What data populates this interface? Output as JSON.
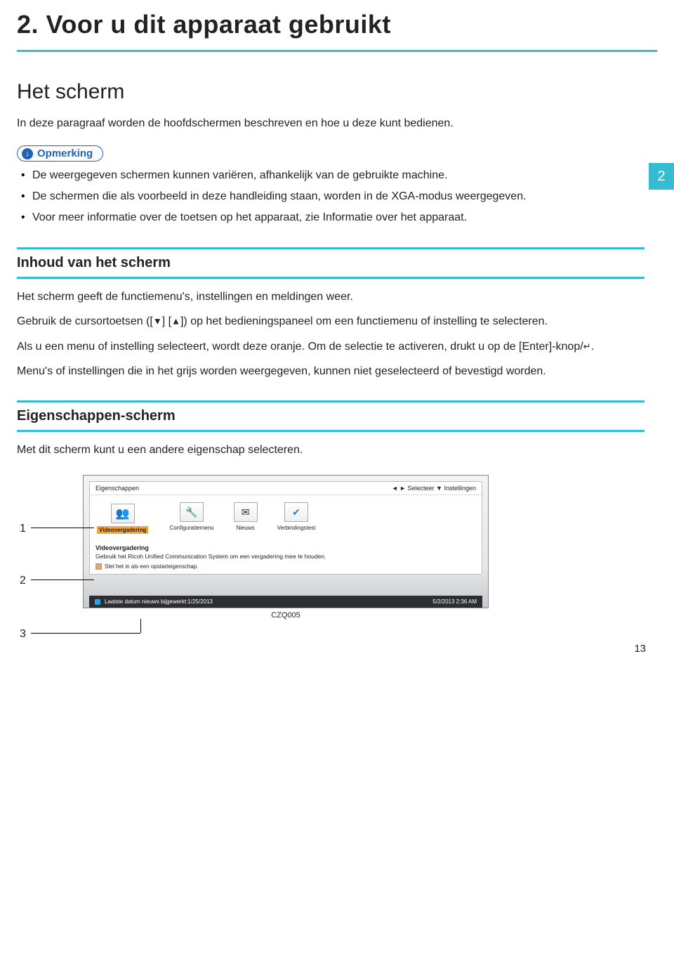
{
  "page": {
    "chapter_title": "2. Voor u dit apparaat gebruikt",
    "tab_label": "2",
    "page_number": "13"
  },
  "section1": {
    "heading": "Het scherm",
    "intro": "In deze paragraaf worden de hoofdschermen beschreven en hoe u deze kunt bedienen.",
    "note_label": "Opmerking",
    "notes": [
      "De weergegeven schermen kunnen variëren, afhankelijk van de gebruikte machine.",
      "De schermen die als voorbeeld in deze handleiding staan, worden in de XGA-modus weergegeven.",
      "Voor meer informatie over de toetsen op het apparaat, zie Informatie over het apparaat."
    ]
  },
  "section2": {
    "heading": "Inhoud van het scherm",
    "p1": "Het scherm geeft de functiemenu's, instellingen en meldingen weer.",
    "p2a": "Gebruik de cursortoetsen ([",
    "p2b": "] [",
    "p2c": "]) op het bedieningspaneel om een functiemenu of instelling te selecteren.",
    "p3a": "Als u een menu of instelling selecteert, wordt deze oranje. Om de selectie te activeren, drukt u op de [Enter]-knop/",
    "p3b": ".",
    "p4": "Menu's of instellingen die in het grijs worden weergegeven, kunnen niet geselecteerd of bevestigd worden."
  },
  "section3": {
    "heading": "Eigenschappen-scherm",
    "intro": "Met dit scherm kunt u een andere eigenschap selecteren."
  },
  "mock": {
    "hdr_left": "Eigenschappen",
    "hdr_right": "◄ ► Selecteer ▼ Instellingen",
    "icons": [
      {
        "label": "Videovergadering"
      },
      {
        "label": "Configuratiemenu"
      },
      {
        "label": "Nieuws"
      },
      {
        "label": "Verbindingstest"
      }
    ],
    "desc_title": "Videovergadering",
    "desc_text": "Gebruik het Ricoh Unified Communication System om een vergadering mee te houden.",
    "checkbox": "Stel het in als een opstarteigenschap.",
    "status_left": "Laatste datum nieuws bijgewerkt:1/25/2013",
    "status_right": "5/2/2013 2:36 AM",
    "caption": "CZQ005"
  },
  "callouts": {
    "c1": "1",
    "c2": "2",
    "c3": "3"
  }
}
